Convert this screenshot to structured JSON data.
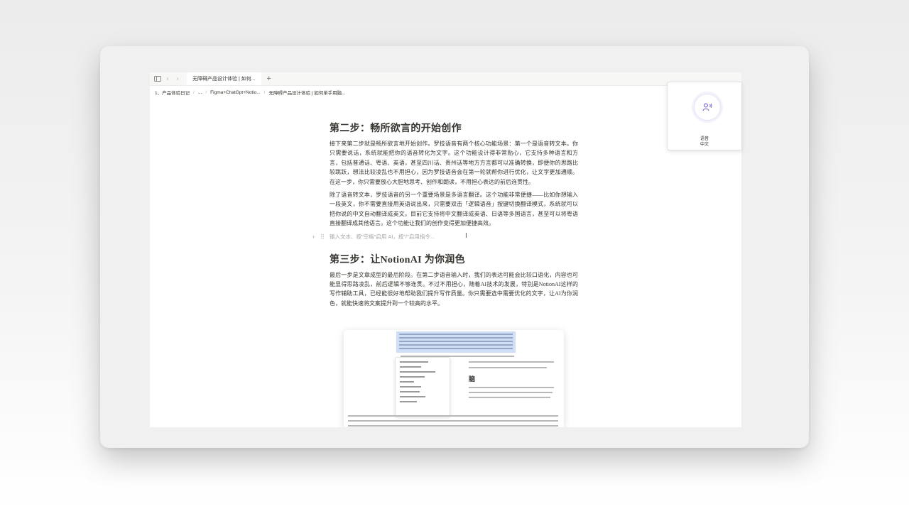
{
  "tabbar": {
    "tab_title": "无障碍产品设计体验 | 如何...",
    "new_tab": "+",
    "icons": [
      "sidebar-icon",
      "back-arrow-icon",
      "forward-arrow-icon"
    ]
  },
  "breadcrumb": {
    "items": [
      "1、产品体验日记",
      "...",
      "Figma+ChatGpt+Notio...",
      "无障碍产品设计体验 | 如何单手用脑..."
    ]
  },
  "content": {
    "h2_step2": "第二步：畅所欲言的开始创作",
    "p1": "接下来第二步就是畅所欲言地开始创作。罗技语音有两个核心功能场景：第一个是语音转文本。你只需要说话，系统就能把你的语音转化为文字。这个功能设计得非常贴心，它支持多种语言和方言，包括普通话、粤语、英语，甚至四川话、贵州话等地方方言都可以准确转换，即便你的思路比较跳跃，想法比较凌乱也不用担心，因为罗技语音会在第一轮就帮你进行优化，让文字更加通顺。在这一步，你只需要放心大胆地思考、创作和朗读，不用担心表达的前后连贯性。",
    "p2": "除了语音转文本，罗技语音的另一个重要场景是多语言翻译。这个功能非常便捷——比如你想输入一段英文，你不需要直接用英语说出来，只需要双击「逻辑语音」按键切换翻译模式，系统就可以把你说的中文自动翻译成英文。目前它支持将中文翻译成英语、日语等多国语言，甚至可以将粤语直接翻译成其他语言。这个功能让我们的创作变得更加便捷高效。",
    "placeholder": "输入文本、按\"空格\"启用 AI，按\"/\"启用指令...",
    "gutter_handle": "+ ⠿",
    "cursor": "I",
    "h2_step3": "第三步：让NotionAI 为你润色",
    "p3": "最后一步是文章成型的最后阶段。在第二步语音输入时，我们的表达可能会比较口语化，内容也可能显得思路凌乱，前后逻辑不够连贯。不过不用担心，随着AI技术的发展，特别是NotionAI这样的写作辅助工具，已经能很好地帮助我们提升写作质量。你只需要选中需要优化的文字，让AI为你润色，就能快速将文案提升到一个较高的水平。"
  },
  "embedded_screenshot": {
    "heading_fragment": "脑"
  },
  "voice_widget": {
    "icon": "voice-person-icon",
    "label_top": "语音",
    "label_bottom": "中文",
    "accent": "#7462d0"
  }
}
